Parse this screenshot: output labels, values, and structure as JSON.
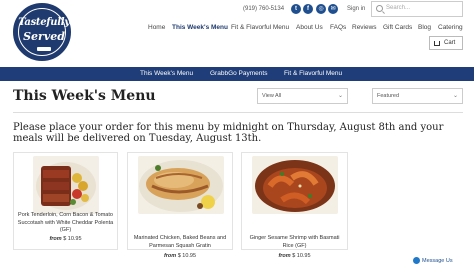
{
  "brand": {
    "logo_line1": "Tastefully",
    "logo_line2": "Served"
  },
  "topbar": {
    "phone": "(919) 760-5134",
    "social_icons": [
      "twitter-icon",
      "facebook-icon",
      "instagram-icon",
      "email-icon"
    ],
    "signin_label": "Sign in",
    "search_placeholder": "Search..."
  },
  "nav": {
    "items": [
      {
        "label": "Home"
      },
      {
        "label": "This Week's Menu",
        "active": true
      },
      {
        "label": "Fit & Flavorful Menu"
      },
      {
        "label": "About Us"
      },
      {
        "label": "FAQs"
      },
      {
        "label": "Reviews"
      },
      {
        "label": "Gift Cards"
      },
      {
        "label": "Blog"
      },
      {
        "label": "Catering"
      }
    ],
    "cart_label": "Cart"
  },
  "subnav": {
    "items": [
      {
        "label": "This Week's Menu"
      },
      {
        "label": "GrabbGo Payments"
      },
      {
        "label": "Fit & Flavorful Menu"
      }
    ],
    "background": "#1f3d78"
  },
  "page": {
    "title": "This Week's Menu",
    "filter_view": "View All",
    "filter_sort": "Featured",
    "notice": "Please place your order for this menu by midnight on Thursday, August 8th and your meals will be delivered on Tuesday, August 13th."
  },
  "products": [
    {
      "name": "Pork Tenderloin, Corn Bacon & Tomato Succotash with White Cheddar Polenta (GF)",
      "price_prefix": "from",
      "price": "$ 10.95"
    },
    {
      "name": "Marinated Chicken, Baked Beans and Parmesan Squash Gratin",
      "price_prefix": "from",
      "price": "$ 10.95"
    },
    {
      "name": "Ginger Sesame Shrimp with Basmati Rice (GF)",
      "price_prefix": "from",
      "price": "$ 10.95"
    }
  ],
  "chat": {
    "label": "Message Us"
  }
}
